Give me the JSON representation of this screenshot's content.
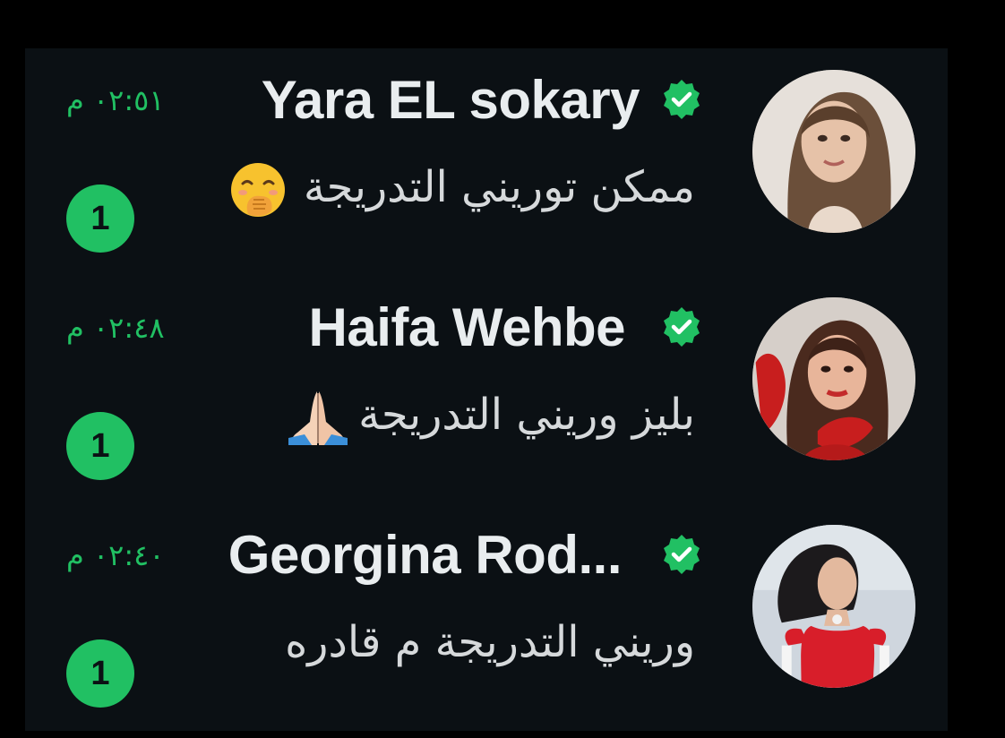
{
  "chats": [
    {
      "name": "Yara EL sokary",
      "time": "٠٢:٥١ م",
      "message": "ممكن توريني التدريجة",
      "emoji_icon": "face-with-hand-over-mouth-icon",
      "unread": "1",
      "verified": true
    },
    {
      "name": "Haifa Wehbe",
      "time": "٠٢:٤٨ م",
      "message": "بليز وريني التدريجة",
      "emoji_icon": "folded-hands-icon",
      "unread": "1",
      "verified": true
    },
    {
      "name": "Georgina Rod...",
      "time": "٠٢:٤٠ م",
      "message": "وريني التدريجة م قادره",
      "emoji_icon": "",
      "unread": "1",
      "verified": true
    }
  ],
  "colors": {
    "background": "#0b1014",
    "accent_green": "#21c063",
    "name_text": "#e9edef",
    "message_text": "#d6d9db"
  }
}
